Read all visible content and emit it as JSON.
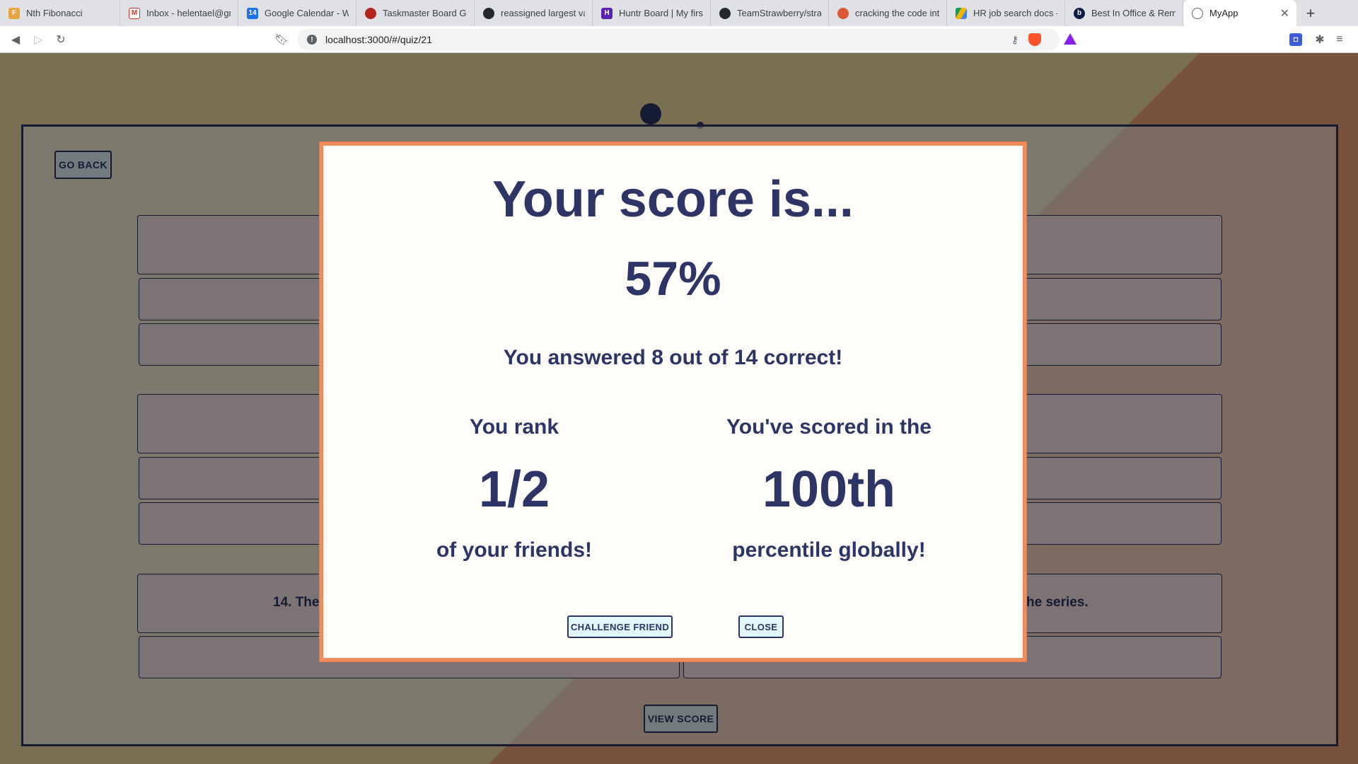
{
  "browser": {
    "tabs": [
      {
        "title": "Nth Fibonacci",
        "icon": "fibonacci-favicon",
        "color": "#e8a33a"
      },
      {
        "title": "Inbox - helentael@gma",
        "icon": "gmail-icon",
        "color": "#d93025"
      },
      {
        "title": "Google Calendar - We",
        "icon": "calendar-icon",
        "color": "#1a73e8"
      },
      {
        "title": "Taskmaster Board Gam",
        "icon": "taskmaster-icon",
        "color": "#b3261e"
      },
      {
        "title": "reassigned largest valu",
        "icon": "github-icon",
        "color": "#24292f"
      },
      {
        "title": "Huntr Board | My first",
        "icon": "huntr-icon",
        "color": "#5b21b6"
      },
      {
        "title": "TeamStrawberry/straw",
        "icon": "github-icon",
        "color": "#24292f"
      },
      {
        "title": "cracking the code inte",
        "icon": "duckduckgo-icon",
        "color": "#de5833"
      },
      {
        "title": "HR job search docs - G",
        "icon": "google-drive-icon",
        "color": "#0f9d58"
      },
      {
        "title": "Best In Office & Remo",
        "icon": "builtin-icon",
        "color": "#0b1f44"
      },
      {
        "title": "MyApp",
        "icon": "globe-icon",
        "color": "#5f6368"
      }
    ],
    "url": "localhost:3000/#/quiz/21"
  },
  "quiz": {
    "go_back_label": "GO BACK",
    "view_score_label": "VIEW SCORE",
    "question_partial_left": "14. The",
    "question_partial_right": "he series."
  },
  "modal": {
    "title": "Your score is...",
    "score": "57%",
    "answered_text": "You answered 8 out of 14 correct!",
    "rank": {
      "heading": "You rank",
      "value": "1/2",
      "footer": "of your friends!"
    },
    "percentile": {
      "heading": "You've scored in the",
      "value": "100th",
      "footer": "percentile globally!"
    },
    "challenge_label": "CHALLENGE FRIEND",
    "close_label": "CLOSE"
  },
  "colors": {
    "navy": "#2c3566",
    "modal_border": "#f08b5b",
    "button_bg": "#e2f7fb",
    "bg_yellow": "#f2e1a5",
    "bg_orange": "#f0a47a"
  }
}
